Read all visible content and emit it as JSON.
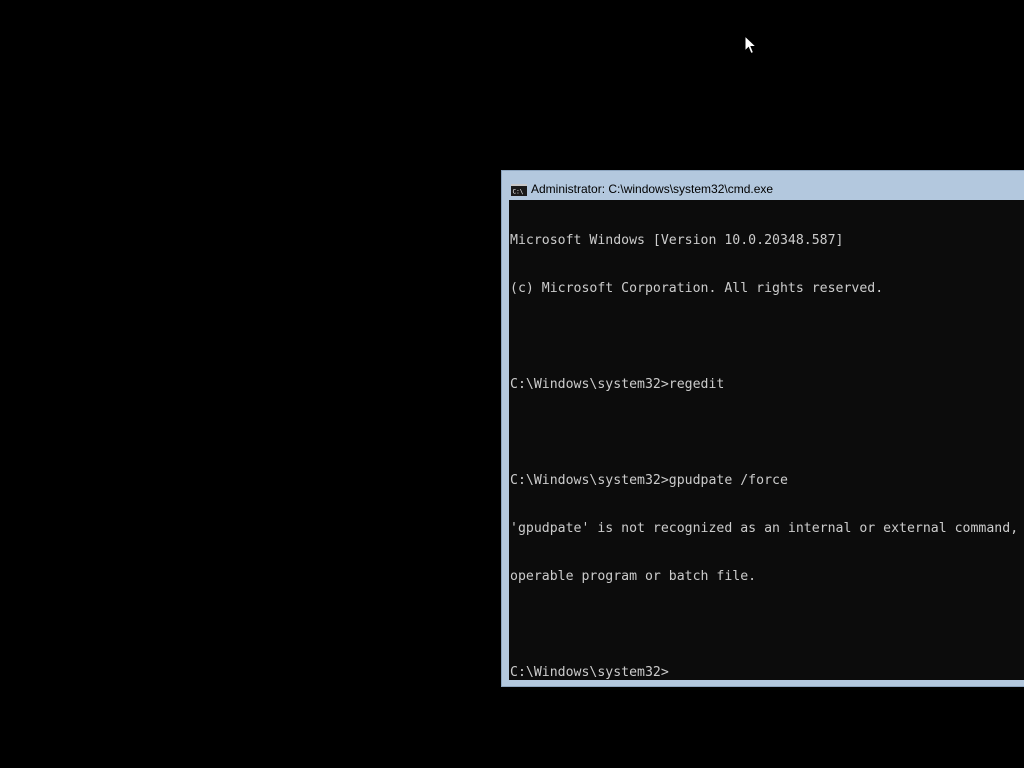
{
  "window": {
    "title": "Administrator: C:\\windows\\system32\\cmd.exe",
    "icon": "cmd-icon"
  },
  "console": {
    "lines": [
      "Microsoft Windows [Version 10.0.20348.587]",
      "(c) Microsoft Corporation. All rights reserved.",
      "",
      "C:\\Windows\\system32>regedit",
      "",
      "C:\\Windows\\system32>gpudpate /force",
      "'gpudpate' is not recognized as an internal or external command,",
      "operable program or batch file.",
      "",
      "C:\\Windows\\system32>"
    ]
  },
  "colors": {
    "desktop": "#000000",
    "window_frame": "#b3c8de",
    "console_background": "#0c0c0c",
    "console_text": "#cccccc"
  },
  "cursor": "mouse-pointer-icon"
}
